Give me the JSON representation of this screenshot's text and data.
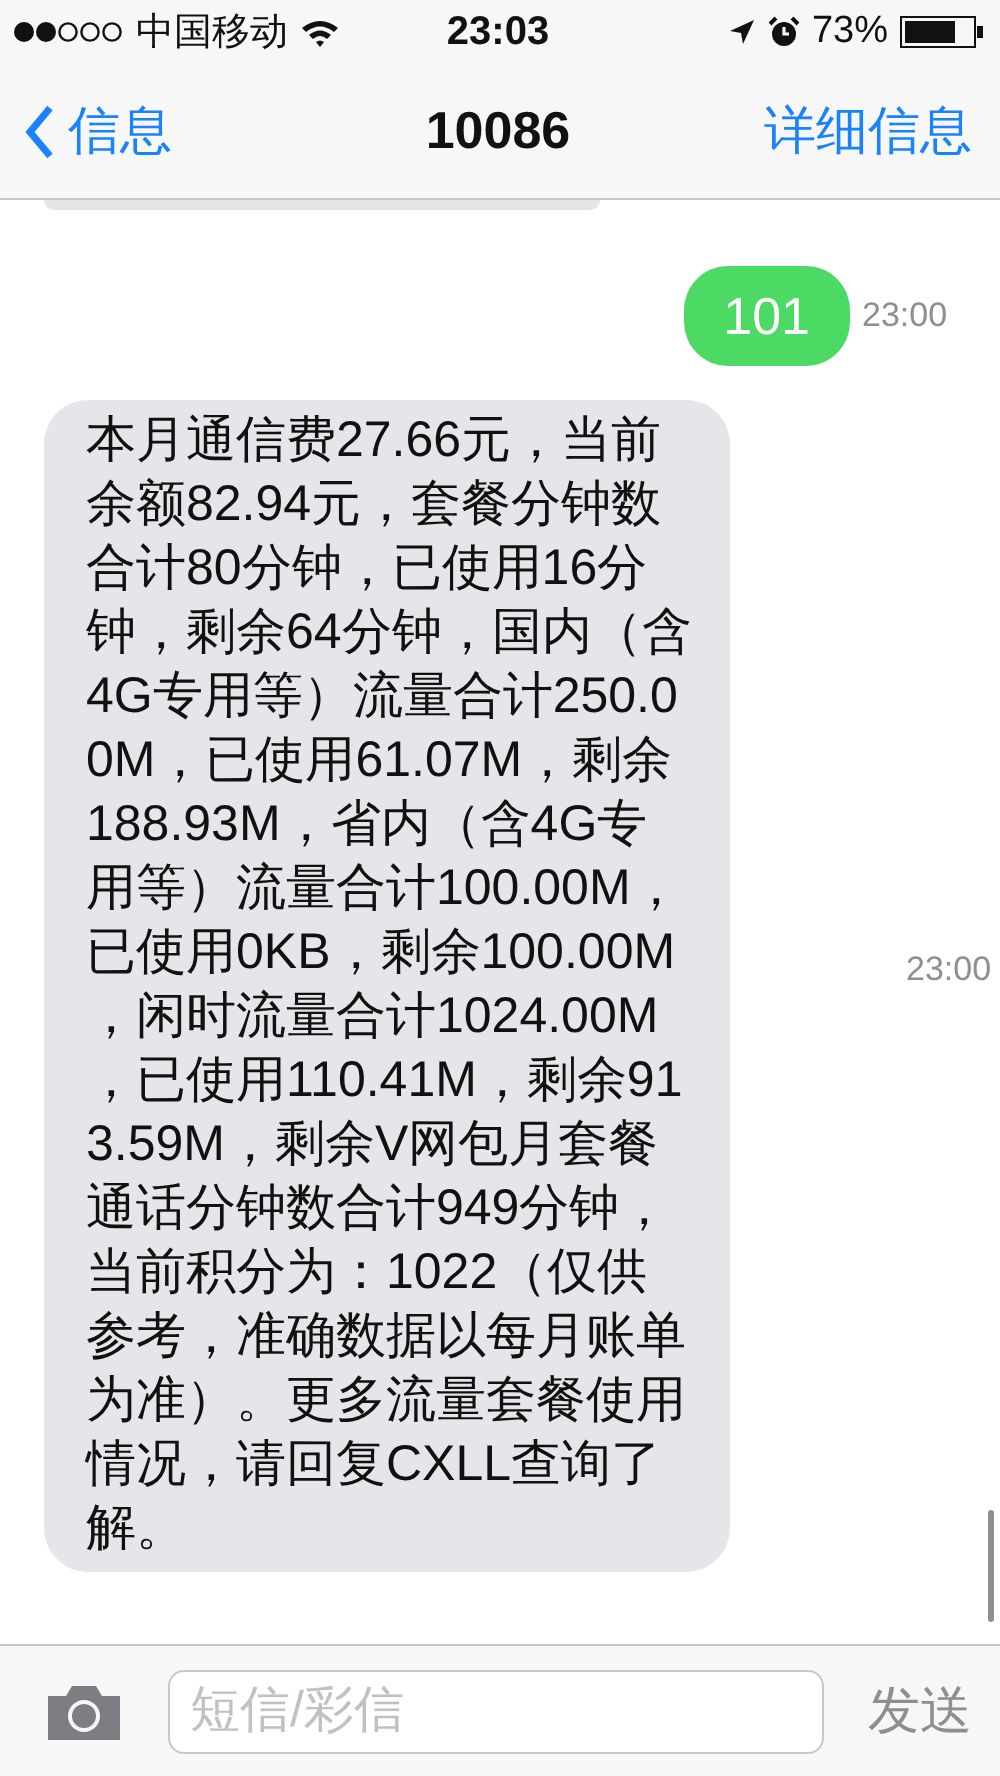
{
  "status_bar": {
    "carrier": "中国移动",
    "time": "23:03",
    "battery": "73%"
  },
  "nav": {
    "back": "信息",
    "title": "10086",
    "action": "详细信息"
  },
  "messages": [
    {
      "kind": "sent",
      "text": "101",
      "time": "23:00"
    },
    {
      "kind": "received",
      "text": "本月通信费27.66元，当前余额82.94元，套餐分钟数合计80分钟，已使用16分钟，剩余64分钟，国内（含4G专用等）流量合计250.00M，已使用61.07M，剩余188.93M，省内（含4G专用等）流量合计100.00M，已使用0KB，剩余100.00M，闲时流量合计1024.00M，已使用110.41M，剩余913.59M，剩余V网包月套餐通话分钟数合计949分钟，当前积分为：1022（仅供参考，准确数据以每月账单为准）。更多流量套餐使用情况，请回复CXLL查询了解。",
      "time": "23:00"
    }
  ],
  "input_bar": {
    "placeholder": "短信/彩信",
    "send": "发送"
  }
}
